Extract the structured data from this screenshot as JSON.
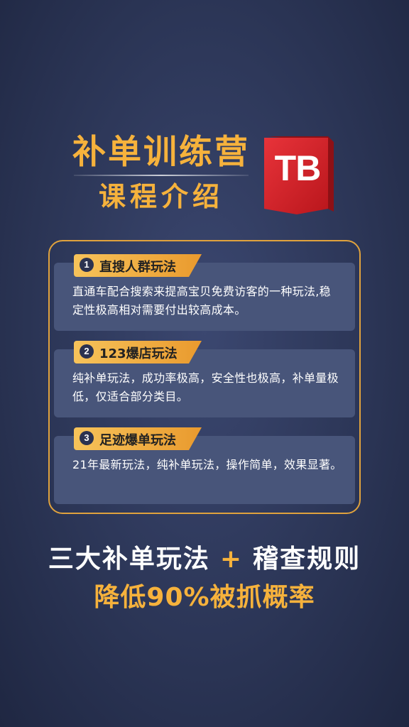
{
  "header": {
    "title": "补单训练营",
    "subtitle": "课程介绍",
    "logo_text": "TB"
  },
  "items": [
    {
      "number": "1",
      "label": "直搜人群玩法",
      "text": "直通车配合搜索来提高宝贝免费访客的一种玩法,稳定性极高相对需要付出较高成本。"
    },
    {
      "number": "2",
      "label": "123爆店玩法",
      "text": "纯补单玩法，成功率极高，安全性也极高，补单量极低，仅适合部分类目。"
    },
    {
      "number": "3",
      "label": "足迹爆单玩法",
      "text": "21年最新玩法，纯补单玩法，操作简单，效果显著。"
    }
  ],
  "footer": {
    "line1_left": "三大补单玩法",
    "plus": "+",
    "line1_right": "稽查规则",
    "line2": "降低90%被抓概率"
  },
  "colors": {
    "accent": "#f6b23c",
    "background": "#2c3657",
    "card": "#48557a",
    "badge_red": "#d8262b"
  }
}
